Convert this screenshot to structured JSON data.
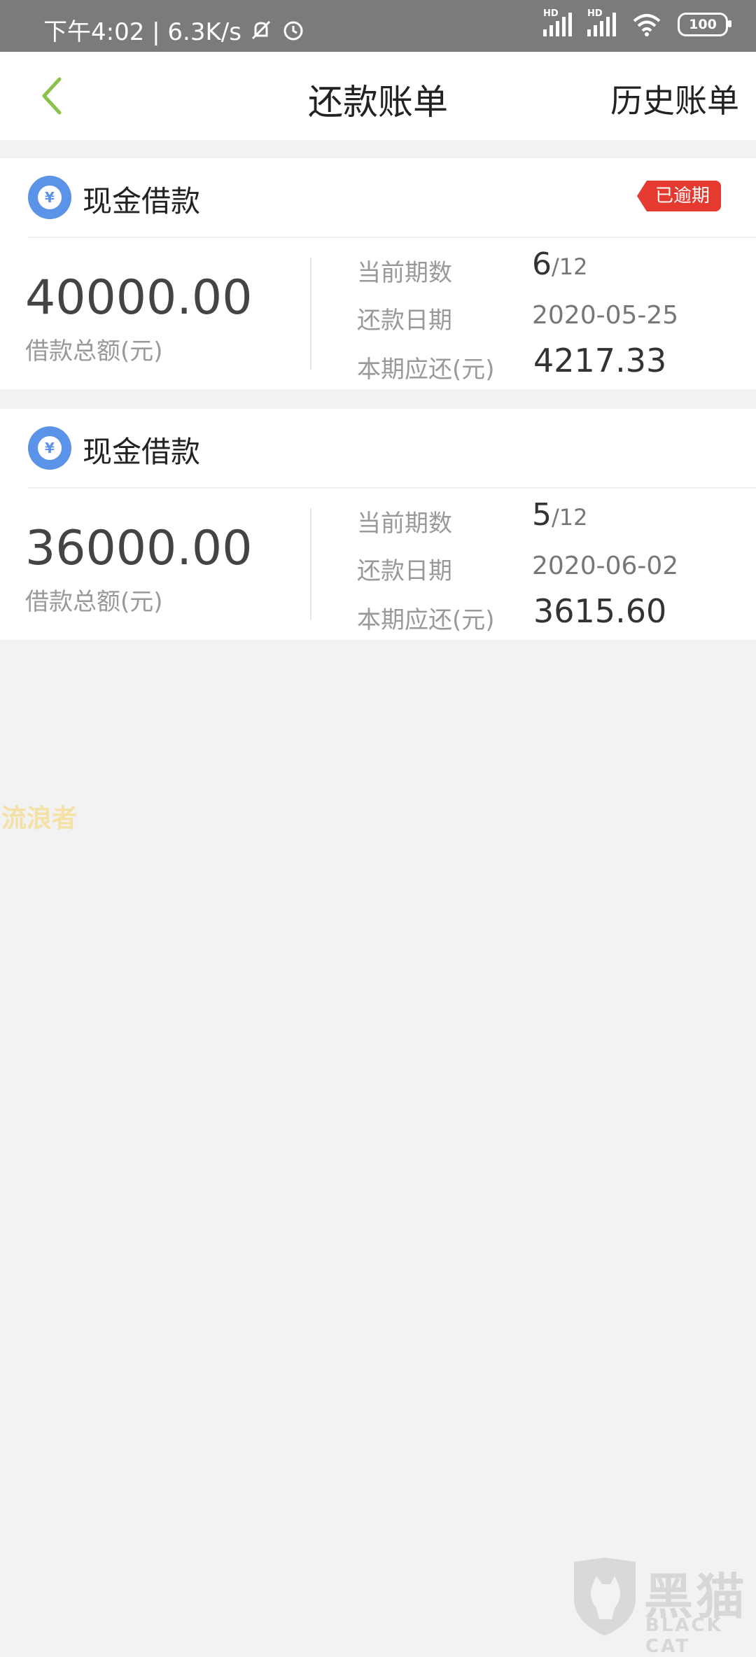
{
  "status_bar": {
    "time_speed": "下午4:02 | 6.3K/s",
    "signal_1_label": "HD",
    "signal_2_label": "HD",
    "battery": "100"
  },
  "header": {
    "title": "还款账单",
    "history_label": "历史账单"
  },
  "loans": [
    {
      "name": "现金借款",
      "badge": "已逾期",
      "coin_symbol": "¥",
      "amount": "40000.00",
      "amount_label": "借款总额(元)",
      "period_label": "当前期数",
      "period_current": "6",
      "period_total": "/12",
      "date_label": "还款日期",
      "date_value": "2020-05-25",
      "due_label": "本期应还(元)",
      "due_value": "4217.33"
    },
    {
      "name": "现金借款",
      "badge": "",
      "coin_symbol": "¥",
      "amount": "36000.00",
      "amount_label": "借款总额(元)",
      "period_label": "当前期数",
      "period_current": "5",
      "period_total": "/12",
      "date_label": "还款日期",
      "date_value": "2020-06-02",
      "due_label": "本期应还(元)",
      "due_value": "3615.60"
    }
  ],
  "watermark": {
    "text": "流浪者",
    "logo_cn": "黑猫",
    "logo_en": "BLACK CAT"
  },
  "colors": {
    "accent_green": "#8bc34a",
    "overdue_red": "#e53a2f",
    "coin_blue": "#5b93e8"
  }
}
